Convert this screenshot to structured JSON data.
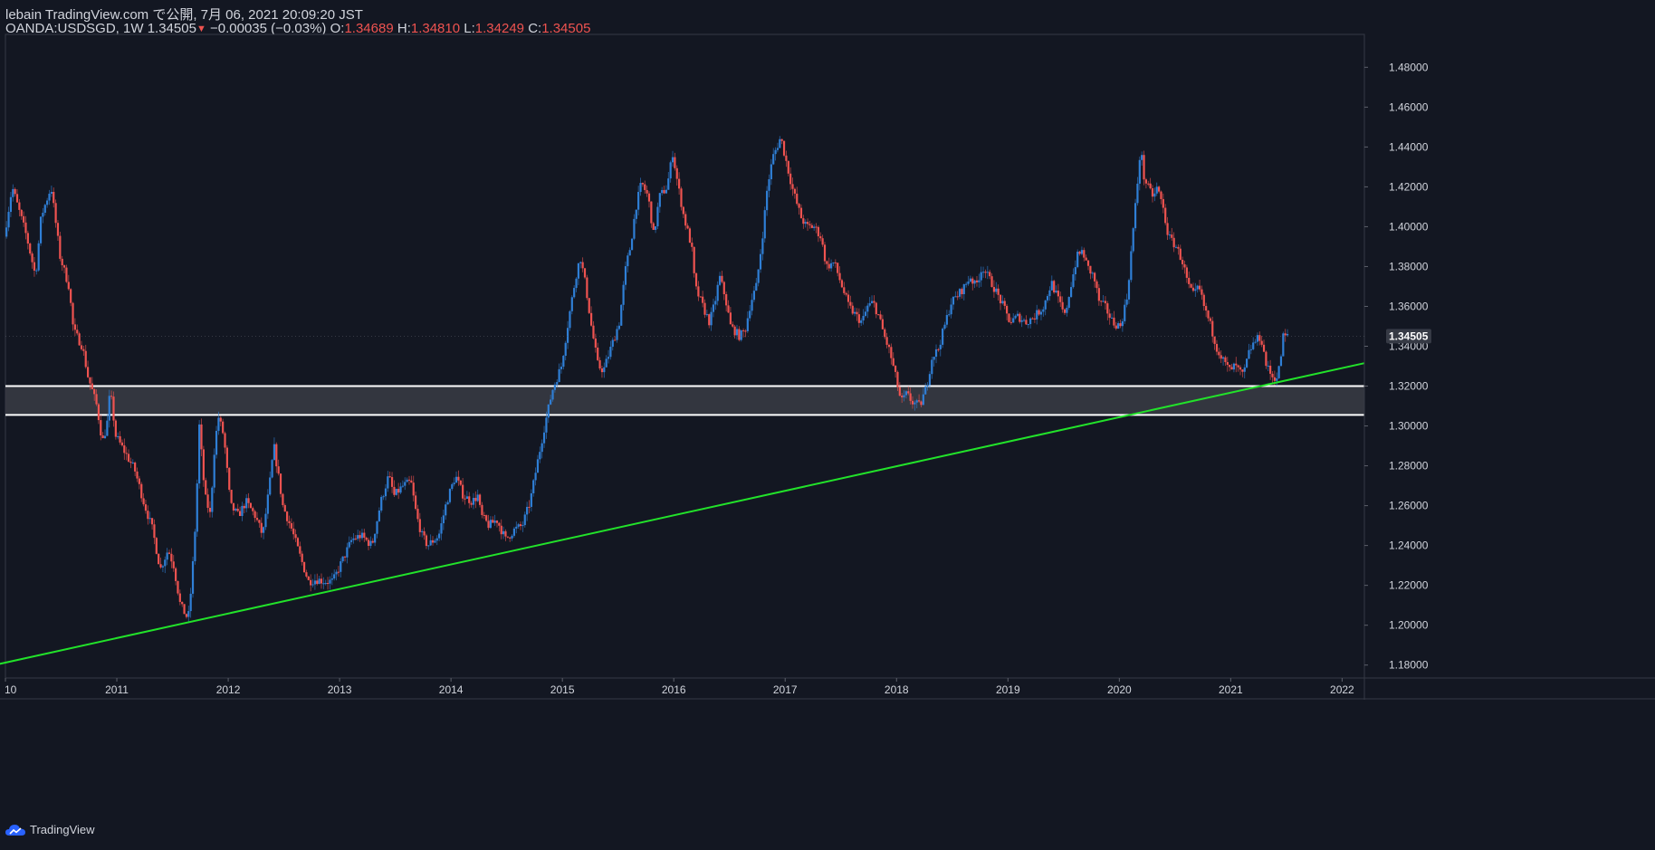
{
  "header": {
    "publish_line": "lebain TradingView.com で公開, 7月 06, 2021 20:09:20 JST",
    "symbol": "OANDA:USDSGD, 1W",
    "last": "1.34505",
    "change": "−0.00035 (−0.03%)",
    "o_label": "O:",
    "o_value": "1.34689",
    "h_label": "H:",
    "h_value": "1.34810",
    "l_label": "L:",
    "l_value": "1.34249",
    "c_label": "C:",
    "c_value": "1.34505"
  },
  "footer": {
    "brand": "TradingView"
  },
  "colors": {
    "background": "#131722",
    "up": "#2f7fd6",
    "down": "#ef5350",
    "trendline": "#22e22a",
    "zone_fill": "#3a3c44",
    "zone_border": "#ffffff",
    "text": "#d1d4dc"
  },
  "chart_data": {
    "type": "candlestick",
    "symbol": "OANDA:USDSGD",
    "interval": "1W",
    "last_price_label": "1.34505",
    "x_tick_labels": [
      "10",
      "2011",
      "2012",
      "2013",
      "2014",
      "2015",
      "2016",
      "2017",
      "2018",
      "2019",
      "2020",
      "2021",
      "2022"
    ],
    "y_tick_labels": [
      "1.18000",
      "1.20000",
      "1.22000",
      "1.24000",
      "1.26000",
      "1.28000",
      "1.30000",
      "1.32000",
      "1.34000",
      "1.36000",
      "1.38000",
      "1.40000",
      "1.42000",
      "1.44000",
      "1.46000",
      "1.48000"
    ],
    "x_range": [
      2010.0,
      2022.2
    ],
    "y_range": [
      1.1735,
      1.4965
    ],
    "price_path": [
      [
        2010.0,
        1.395
      ],
      [
        2010.07,
        1.42
      ],
      [
        2010.2,
        1.395
      ],
      [
        2010.28,
        1.375
      ],
      [
        2010.33,
        1.405
      ],
      [
        2010.42,
        1.42
      ],
      [
        2010.5,
        1.385
      ],
      [
        2010.58,
        1.37
      ],
      [
        2010.62,
        1.348
      ],
      [
        2010.7,
        1.34
      ],
      [
        2010.75,
        1.325
      ],
      [
        2010.83,
        1.31
      ],
      [
        2010.88,
        1.292
      ],
      [
        2010.92,
        1.3
      ],
      [
        2010.95,
        1.318
      ],
      [
        2011.0,
        1.295
      ],
      [
        2011.1,
        1.285
      ],
      [
        2011.17,
        1.278
      ],
      [
        2011.25,
        1.262
      ],
      [
        2011.33,
        1.248
      ],
      [
        2011.4,
        1.228
      ],
      [
        2011.47,
        1.238
      ],
      [
        2011.52,
        1.23
      ],
      [
        2011.58,
        1.21
      ],
      [
        2011.65,
        1.203
      ],
      [
        2011.68,
        1.22
      ],
      [
        2011.72,
        1.255
      ],
      [
        2011.75,
        1.3
      ],
      [
        2011.8,
        1.265
      ],
      [
        2011.85,
        1.255
      ],
      [
        2011.88,
        1.285
      ],
      [
        2011.92,
        1.305
      ],
      [
        2011.97,
        1.295
      ],
      [
        2012.03,
        1.26
      ],
      [
        2012.1,
        1.255
      ],
      [
        2012.17,
        1.262
      ],
      [
        2012.25,
        1.255
      ],
      [
        2012.32,
        1.245
      ],
      [
        2012.38,
        1.27
      ],
      [
        2012.42,
        1.29
      ],
      [
        2012.5,
        1.26
      ],
      [
        2012.58,
        1.248
      ],
      [
        2012.67,
        1.232
      ],
      [
        2012.73,
        1.222
      ],
      [
        2012.8,
        1.223
      ],
      [
        2012.88,
        1.222
      ],
      [
        2012.95,
        1.222
      ],
      [
        2013.03,
        1.232
      ],
      [
        2013.12,
        1.243
      ],
      [
        2013.2,
        1.245
      ],
      [
        2013.3,
        1.24
      ],
      [
        2013.38,
        1.262
      ],
      [
        2013.45,
        1.275
      ],
      [
        2013.5,
        1.265
      ],
      [
        2013.58,
        1.27
      ],
      [
        2013.65,
        1.272
      ],
      [
        2013.7,
        1.255
      ],
      [
        2013.75,
        1.245
      ],
      [
        2013.8,
        1.24
      ],
      [
        2013.9,
        1.245
      ],
      [
        2013.97,
        1.262
      ],
      [
        2014.05,
        1.275
      ],
      [
        2014.12,
        1.265
      ],
      [
        2014.2,
        1.262
      ],
      [
        2014.25,
        1.265
      ],
      [
        2014.28,
        1.255
      ],
      [
        2014.35,
        1.25
      ],
      [
        2014.42,
        1.253
      ],
      [
        2014.5,
        1.243
      ],
      [
        2014.58,
        1.248
      ],
      [
        2014.65,
        1.25
      ],
      [
        2014.72,
        1.262
      ],
      [
        2014.78,
        1.28
      ],
      [
        2014.85,
        1.3
      ],
      [
        2014.92,
        1.318
      ],
      [
        2015.0,
        1.33
      ],
      [
        2015.07,
        1.355
      ],
      [
        2015.13,
        1.375
      ],
      [
        2015.17,
        1.385
      ],
      [
        2015.22,
        1.37
      ],
      [
        2015.27,
        1.35
      ],
      [
        2015.33,
        1.33
      ],
      [
        2015.38,
        1.328
      ],
      [
        2015.45,
        1.34
      ],
      [
        2015.52,
        1.352
      ],
      [
        2015.58,
        1.38
      ],
      [
        2015.62,
        1.39
      ],
      [
        2015.67,
        1.41
      ],
      [
        2015.72,
        1.422
      ],
      [
        2015.78,
        1.415
      ],
      [
        2015.83,
        1.395
      ],
      [
        2015.88,
        1.415
      ],
      [
        2015.95,
        1.42
      ],
      [
        2016.0,
        1.437
      ],
      [
        2016.05,
        1.42
      ],
      [
        2016.1,
        1.405
      ],
      [
        2016.17,
        1.39
      ],
      [
        2016.2,
        1.37
      ],
      [
        2016.27,
        1.36
      ],
      [
        2016.33,
        1.352
      ],
      [
        2016.38,
        1.362
      ],
      [
        2016.42,
        1.375
      ],
      [
        2016.47,
        1.365
      ],
      [
        2016.52,
        1.35
      ],
      [
        2016.6,
        1.345
      ],
      [
        2016.65,
        1.348
      ],
      [
        2016.7,
        1.362
      ],
      [
        2016.75,
        1.37
      ],
      [
        2016.8,
        1.392
      ],
      [
        2016.85,
        1.42
      ],
      [
        2016.9,
        1.435
      ],
      [
        2016.97,
        1.445
      ],
      [
        2017.03,
        1.43
      ],
      [
        2017.08,
        1.418
      ],
      [
        2017.15,
        1.405
      ],
      [
        2017.2,
        1.4
      ],
      [
        2017.27,
        1.4
      ],
      [
        2017.33,
        1.395
      ],
      [
        2017.38,
        1.38
      ],
      [
        2017.45,
        1.382
      ],
      [
        2017.52,
        1.37
      ],
      [
        2017.58,
        1.36
      ],
      [
        2017.65,
        1.355
      ],
      [
        2017.7,
        1.352
      ],
      [
        2017.75,
        1.36
      ],
      [
        2017.8,
        1.362
      ],
      [
        2017.85,
        1.355
      ],
      [
        2017.9,
        1.345
      ],
      [
        2017.95,
        1.337
      ],
      [
        2018.0,
        1.325
      ],
      [
        2018.05,
        1.312
      ],
      [
        2018.1,
        1.316
      ],
      [
        2018.15,
        1.312
      ],
      [
        2018.22,
        1.31
      ],
      [
        2018.28,
        1.32
      ],
      [
        2018.33,
        1.335
      ],
      [
        2018.38,
        1.338
      ],
      [
        2018.45,
        1.352
      ],
      [
        2018.5,
        1.362
      ],
      [
        2018.55,
        1.365
      ],
      [
        2018.62,
        1.37
      ],
      [
        2018.67,
        1.375
      ],
      [
        2018.72,
        1.37
      ],
      [
        2018.78,
        1.38
      ],
      [
        2018.83,
        1.375
      ],
      [
        2018.88,
        1.37
      ],
      [
        2018.95,
        1.362
      ],
      [
        2019.03,
        1.352
      ],
      [
        2019.1,
        1.355
      ],
      [
        2019.17,
        1.352
      ],
      [
        2019.25,
        1.355
      ],
      [
        2019.33,
        1.36
      ],
      [
        2019.4,
        1.372
      ],
      [
        2019.45,
        1.365
      ],
      [
        2019.52,
        1.355
      ],
      [
        2019.58,
        1.372
      ],
      [
        2019.63,
        1.385
      ],
      [
        2019.68,
        1.388
      ],
      [
        2019.72,
        1.38
      ],
      [
        2019.78,
        1.375
      ],
      [
        2019.83,
        1.362
      ],
      [
        2019.88,
        1.36
      ],
      [
        2019.95,
        1.352
      ],
      [
        2020.02,
        1.35
      ],
      [
        2020.08,
        1.365
      ],
      [
        2020.12,
        1.39
      ],
      [
        2020.17,
        1.42
      ],
      [
        2020.2,
        1.44
      ],
      [
        2020.23,
        1.425
      ],
      [
        2020.28,
        1.418
      ],
      [
        2020.32,
        1.415
      ],
      [
        2020.35,
        1.42
      ],
      [
        2020.4,
        1.41
      ],
      [
        2020.45,
        1.395
      ],
      [
        2020.52,
        1.39
      ],
      [
        2020.58,
        1.382
      ],
      [
        2020.63,
        1.37
      ],
      [
        2020.68,
        1.365
      ],
      [
        2020.72,
        1.37
      ],
      [
        2020.77,
        1.36
      ],
      [
        2020.82,
        1.352
      ],
      [
        2020.88,
        1.34
      ],
      [
        2020.95,
        1.332
      ],
      [
        2021.0,
        1.328
      ],
      [
        2021.05,
        1.33
      ],
      [
        2021.12,
        1.325
      ],
      [
        2021.18,
        1.338
      ],
      [
        2021.22,
        1.342
      ],
      [
        2021.28,
        1.345
      ],
      [
        2021.33,
        1.33
      ],
      [
        2021.38,
        1.325
      ],
      [
        2021.42,
        1.324
      ],
      [
        2021.45,
        1.33
      ],
      [
        2021.48,
        1.345
      ],
      [
        2021.51,
        1.345
      ]
    ],
    "horizontal_zone": {
      "low": 1.3055,
      "high": 1.32
    },
    "trendline": {
      "start": [
        2009.9,
        1.18
      ],
      "end": [
        2022.2,
        1.3315
      ]
    }
  }
}
